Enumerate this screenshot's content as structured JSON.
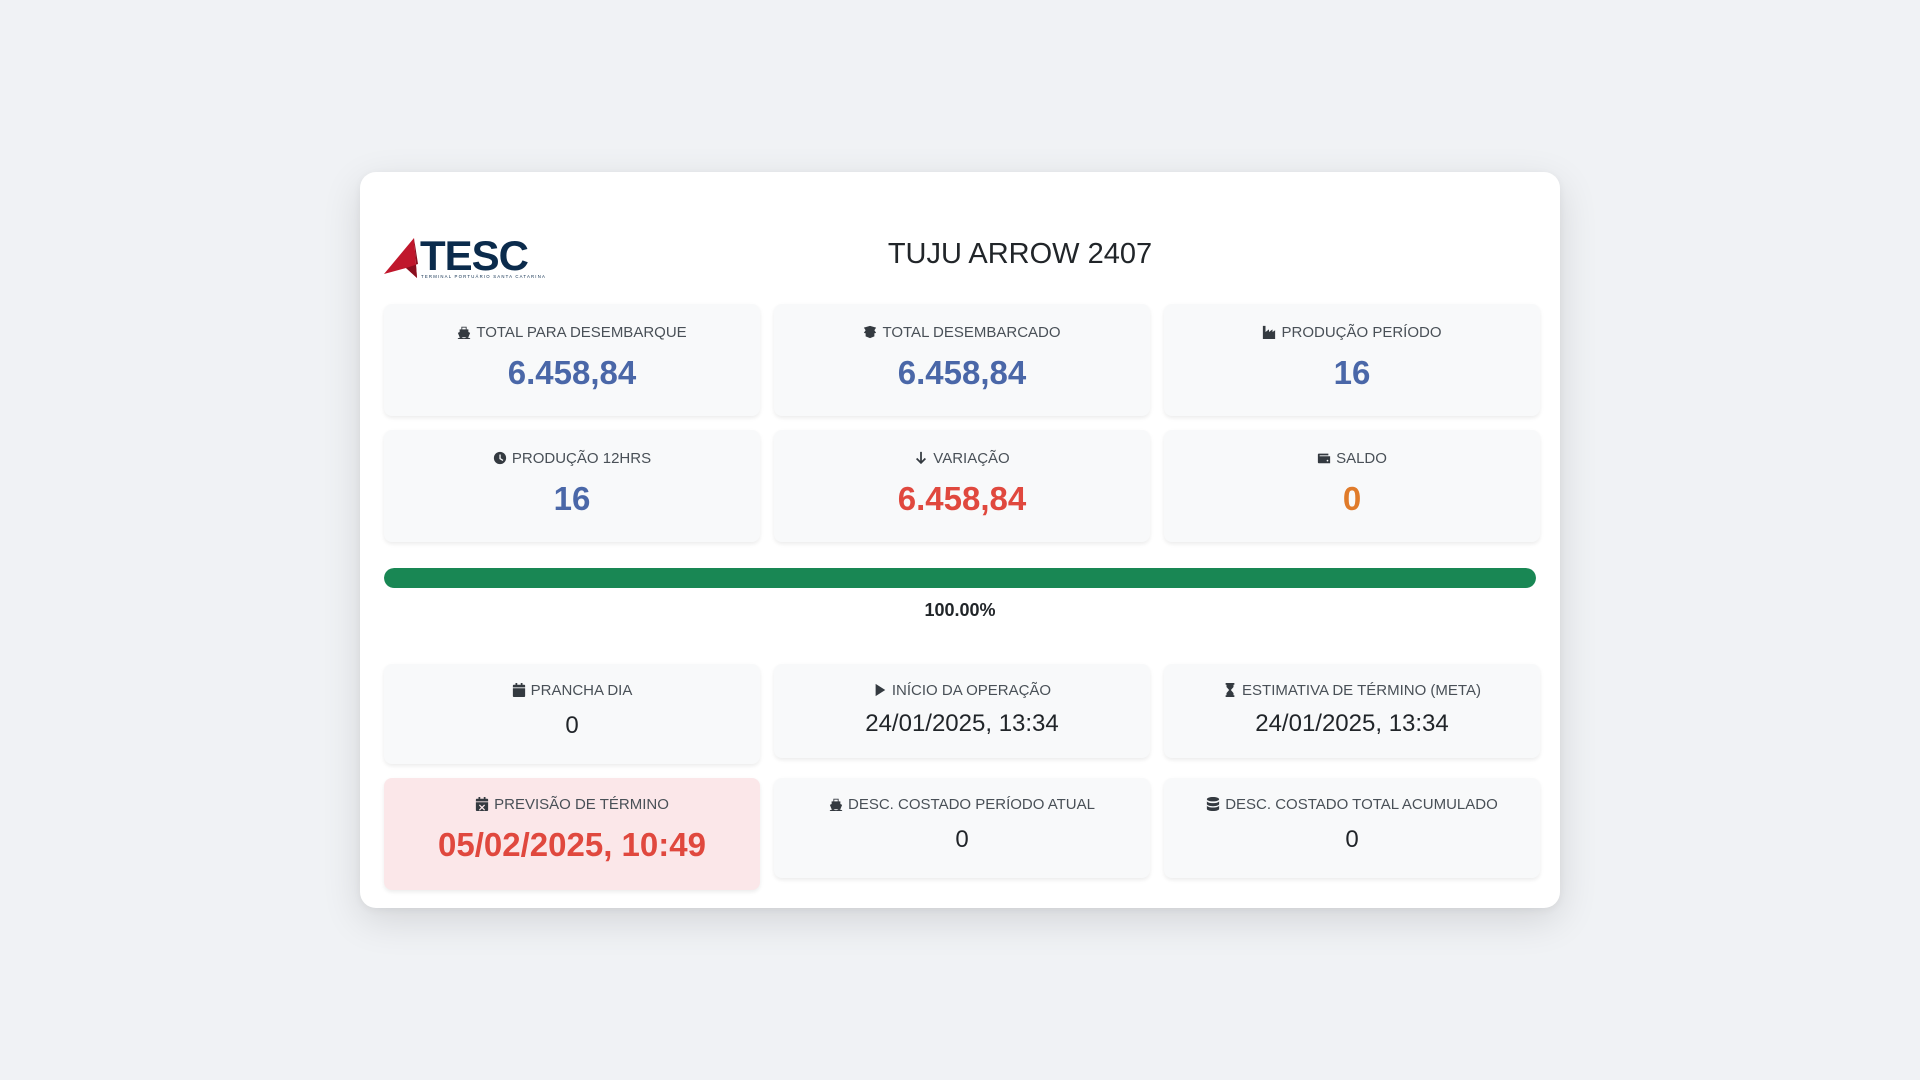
{
  "header": {
    "logo_text": "TESC",
    "logo_subtitle": "TERMINAL PORTUÁRIO SANTA CATARINA",
    "title": "TUJU ARROW 2407"
  },
  "stats": [
    {
      "label": "TOTAL PARA DESEMBARQUE",
      "icon": "ship-icon",
      "value": "6.458,84"
    },
    {
      "label": "TOTAL DESEMBARCADO",
      "icon": "box-icon",
      "value": "6.458,84"
    },
    {
      "label": "PRODUÇÃO PERÍODO",
      "icon": "industry-icon",
      "value": "16"
    },
    {
      "label": "PRODUÇÃO 12HRS",
      "icon": "clock-icon",
      "value": "16"
    },
    {
      "label": "VARIAÇÃO",
      "icon": "arrow-down-icon",
      "value": "6.458,84"
    },
    {
      "label": "SALDO",
      "icon": "wallet-icon",
      "value": "0"
    }
  ],
  "progress": {
    "percent": 100,
    "label": "100.00%"
  },
  "info": [
    {
      "label": "PRANCHA DIA",
      "icon": "calendar-icon",
      "value": "0"
    },
    {
      "label": "INÍCIO DA OPERAÇÃO",
      "icon": "play-icon",
      "value": "24/01/2025, 13:34"
    },
    {
      "label": "ESTIMATIVA DE TÉRMINO (META)",
      "icon": "hourglass-icon",
      "value": "24/01/2025, 13:34"
    },
    {
      "label": "PREVISÃO DE TÉRMINO",
      "icon": "calendar-x-icon",
      "value": "05/02/2025, 10:49"
    },
    {
      "label": "DESC. COSTADO PERÍODO ATUAL",
      "icon": "ship-icon",
      "value": "0"
    },
    {
      "label": "DESC. COSTADO TOTAL ACUMULADO",
      "icon": "database-icon",
      "value": "0"
    }
  ],
  "colors": {
    "value_blue": "#4a67a8",
    "value_red": "#e0483e",
    "value_orange": "#e07b2a",
    "progress_green": "#198754",
    "alert_bg": "#fbe7e9"
  }
}
